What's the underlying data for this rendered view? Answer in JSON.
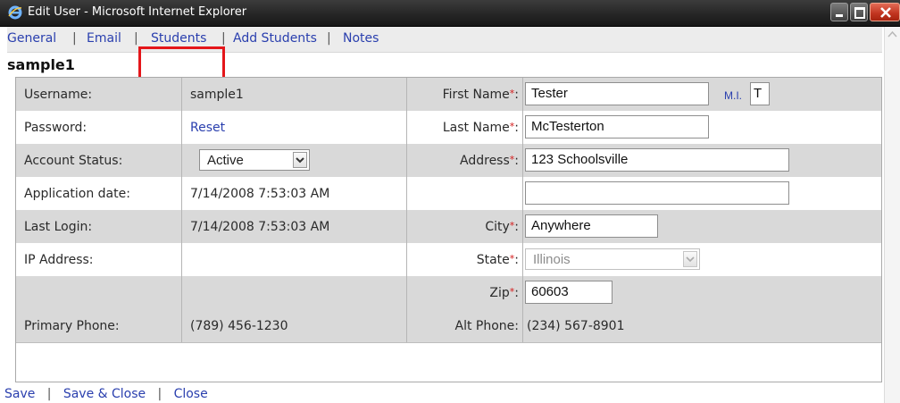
{
  "window": {
    "title": "Edit User - Microsoft Internet Explorer",
    "icon": "ie-icon",
    "controls": [
      "minimize-icon",
      "maximize-icon",
      "close-icon"
    ],
    "colors": {
      "titlebar": "#262626",
      "close": "#c0341f"
    }
  },
  "tabs": [
    {
      "label": "General"
    },
    {
      "label": "Email"
    },
    {
      "label": "Students",
      "highlighted": true
    },
    {
      "label": "Add Students"
    },
    {
      "label": "Notes"
    }
  ],
  "tab_separator": "|",
  "username_heading": "sample1",
  "left": {
    "username_label": "Username:",
    "username_value": "sample1",
    "password_label": "Password:",
    "password_link": "Reset",
    "account_status_label": "Account Status:",
    "account_status_value": "Active",
    "application_date_label": "Application date:",
    "application_date_value": "7/14/2008 7:53:03 AM",
    "last_login_label": "Last Login:",
    "last_login_value": "7/14/2008 7:53:03 AM",
    "ip_address_label": "IP Address:",
    "ip_address_value": "",
    "primary_phone_label": "Primary Phone:",
    "primary_phone_value": "(789) 456-1230"
  },
  "right": {
    "required_mark": "*",
    "first_name_label": "First Name",
    "first_name_value": "Tester",
    "mi_label": "M.I.",
    "mi_value": "T",
    "last_name_label": "Last Name",
    "last_name_value": "McTesterton",
    "address_label": "Address",
    "address_value": "123 Schoolsville",
    "address2_value": "",
    "city_label": "City",
    "city_value": "Anywhere",
    "state_label": "State",
    "state_value": "Illinois",
    "zip_label": "Zip",
    "zip_value": "60603",
    "alt_phone_label": "Alt Phone:",
    "alt_phone_value": "(234) 567-8901"
  },
  "footer": {
    "save": "Save",
    "save_close": "Save & Close",
    "close": "Close",
    "separator": "|"
  },
  "colors": {
    "link": "#2a3fae",
    "required": "#d41a1a",
    "highlight": "#e4161a",
    "row_shade": "#d9d9d9"
  }
}
